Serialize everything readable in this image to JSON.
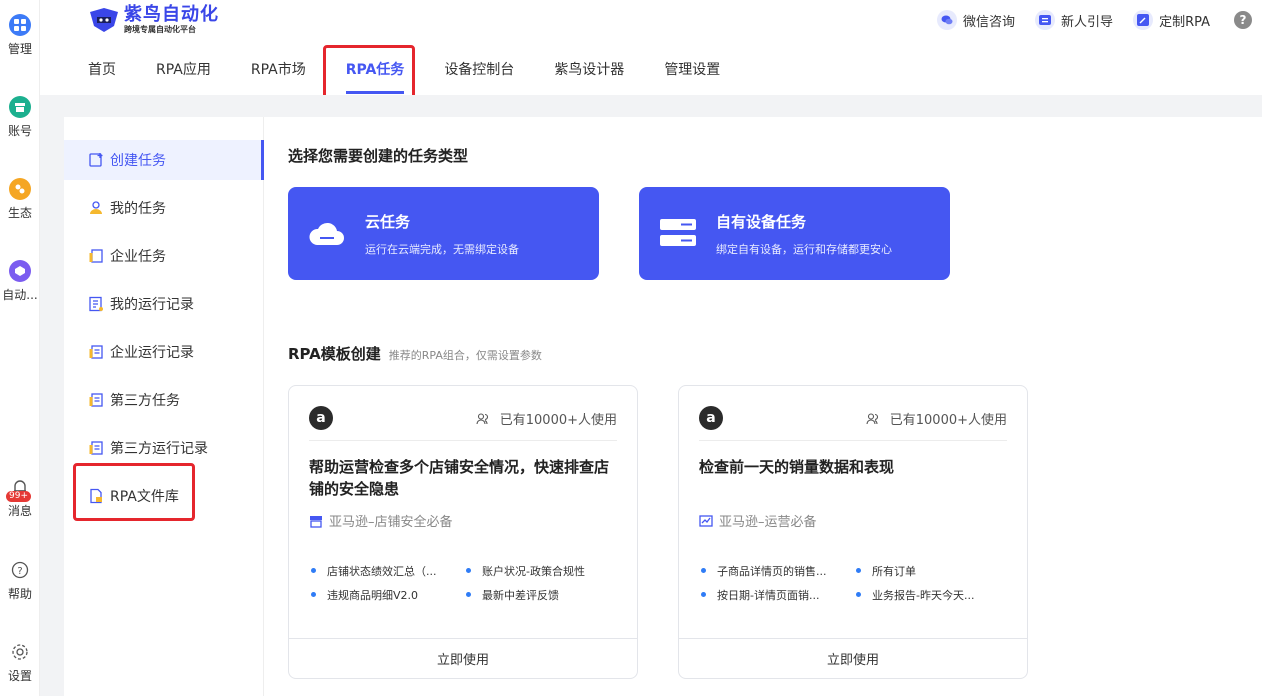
{
  "rail": {
    "items": [
      {
        "label": "管理",
        "icon": "grid-icon",
        "color": "#3d7bf7"
      },
      {
        "label": "账号",
        "icon": "store-icon",
        "color": "#1cb08f"
      },
      {
        "label": "生态",
        "icon": "ecosystem-icon",
        "color": "#f5a623"
      },
      {
        "label": "自动...",
        "icon": "automation-icon",
        "color": "#7b5cf0"
      }
    ],
    "bottom": [
      {
        "label": "消息",
        "icon": "bell-icon",
        "badge": "99+"
      },
      {
        "label": "帮助",
        "icon": "help-circle-icon"
      },
      {
        "label": "设置",
        "icon": "gear-icon"
      }
    ]
  },
  "header": {
    "logo_title": "紫鸟自动化",
    "logo_subtitle": "跨境专属自动化平台",
    "nav": [
      "首页",
      "RPA应用",
      "RPA市场",
      "RPA任务",
      "设备控制台",
      "紫鸟设计器",
      "管理设置"
    ],
    "active_nav": "RPA任务",
    "top_right": [
      {
        "label": "微信咨询",
        "icon": "wechat-icon"
      },
      {
        "label": "新人引导",
        "icon": "guide-icon"
      },
      {
        "label": "定制RPA",
        "icon": "edit-icon"
      }
    ],
    "help": "?"
  },
  "side_menu": {
    "items": [
      {
        "label": "创建任务",
        "icon": "create-task-icon"
      },
      {
        "label": "我的任务",
        "icon": "user-task-icon"
      },
      {
        "label": "企业任务",
        "icon": "enterprise-task-icon"
      },
      {
        "label": "我的运行记录",
        "icon": "run-record-icon"
      },
      {
        "label": "企业运行记录",
        "icon": "enterprise-record-icon"
      },
      {
        "label": "第三方任务",
        "icon": "third-party-task-icon"
      },
      {
        "label": "第三方运行记录",
        "icon": "third-party-record-icon"
      },
      {
        "label": "RPA文件库",
        "icon": "file-library-icon"
      }
    ],
    "active": "创建任务"
  },
  "main": {
    "select_title": "选择您需要创建的任务类型",
    "task_types": [
      {
        "title": "云任务",
        "desc": "运行在云端完成，无需绑定设备",
        "icon": "cloud-icon"
      },
      {
        "title": "自有设备任务",
        "desc": "绑定自有设备，运行和存储都更安心",
        "icon": "server-icon"
      }
    ],
    "template_title": "RPA模板创建",
    "template_subtitle": "推荐的RPA组合，仅需设置参数",
    "templates": [
      {
        "logo": "a",
        "users": "已有10000+人使用",
        "title": "帮助运营检查多个店铺安全情况，快速排查店铺的安全隐患",
        "tag": "亚马逊–店铺安全必备",
        "tag_icon": "store-icon",
        "steps": [
          "店铺状态绩效汇总（...",
          "账户状况-政策合规性",
          "违规商品明细V2.0",
          "最新中差评反馈"
        ],
        "button": "立即使用"
      },
      {
        "logo": "a",
        "users": "已有10000+人使用",
        "title": "检查前一天的销量数据和表现",
        "tag": "亚马逊–运营必备",
        "tag_icon": "chart-icon",
        "steps": [
          "子商品详情页的销售...",
          "所有订单",
          "按日期-详情页面销...",
          "业务报告-昨天今天..."
        ],
        "button": "立即使用"
      }
    ]
  },
  "colors": {
    "accent": "#4557f2",
    "highlight": "#e5262d"
  }
}
